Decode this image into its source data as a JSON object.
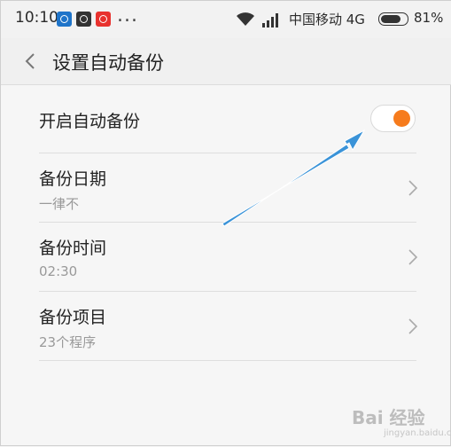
{
  "status_bar": {
    "time": "10:10",
    "dots": "...",
    "carrier": "中国移动 4G",
    "battery_percent": "81%",
    "battery_level": 0.81
  },
  "header": {
    "title": "设置自动备份"
  },
  "settings": [
    {
      "label": "开启自动备份",
      "type": "toggle",
      "enabled": true
    },
    {
      "label": "备份日期",
      "value": "一律不"
    },
    {
      "label": "备份时间",
      "value": "02:30"
    },
    {
      "label": "备份项目",
      "value": "23个程序"
    }
  ],
  "colors": {
    "toggle_on": "#f67b1c",
    "annotation_arrow": "#3a93d8"
  },
  "watermark": {
    "brand": "Bai 经验",
    "url": "jingyan.baidu.com"
  }
}
